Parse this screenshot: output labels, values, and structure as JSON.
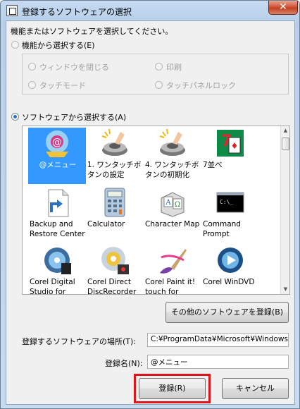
{
  "window": {
    "title": "登録するソフトウェアの選択",
    "close_symbol": "✕"
  },
  "instruction": "機能またはソフトウェアを選択してください。",
  "function_option": {
    "label": "機能から選択する(E)",
    "items": [
      "ウィンドウを閉じる",
      "印刷",
      "タッチモード",
      "タッチパネルロック"
    ]
  },
  "software_option": {
    "label": "ソフトウェアから選択する(A)",
    "selected_index": 0,
    "items": [
      {
        "label": "@メニュー",
        "icon": "at-menu-icon"
      },
      {
        "label": "1. ワンタッチボタンの設定",
        "icon": "one-touch-button-icon"
      },
      {
        "label": "4. ワンタッチボタンの初期化",
        "icon": "one-touch-button-icon"
      },
      {
        "label": "7並べ",
        "icon": "card-game-icon"
      },
      {
        "label": "Backup and Restore Center",
        "icon": "backup-icon"
      },
      {
        "label": "Calculator",
        "icon": "calculator-icon"
      },
      {
        "label": "Character Map",
        "icon": "character-map-icon"
      },
      {
        "label": "Command Prompt",
        "icon": "command-prompt-icon"
      },
      {
        "label": "Corel Digital Studio for FUJITSU",
        "icon": "dvd-disc-icon"
      },
      {
        "label": "Corel Direct DiscRecorder",
        "icon": "disc-recorder-icon"
      },
      {
        "label": "Corel Paint it! touch for FUJITSU",
        "icon": "paint-brush-icon"
      },
      {
        "label": "Corel WinDVD",
        "icon": "windvd-icon"
      }
    ]
  },
  "register_other_button": "その他のソフトウェアを登録(B)",
  "location_label": "登録するソフトウェアの場所(T):",
  "location_value": "C:¥ProgramData¥Microsoft¥Windows¥Sta",
  "name_label": "登録名(N):",
  "name_value": "@メニュー",
  "register_button": "登録(R)",
  "cancel_button": "キャンセル",
  "colors": {
    "selection": "#3399ff",
    "highlight_frame": "#e0141b"
  }
}
